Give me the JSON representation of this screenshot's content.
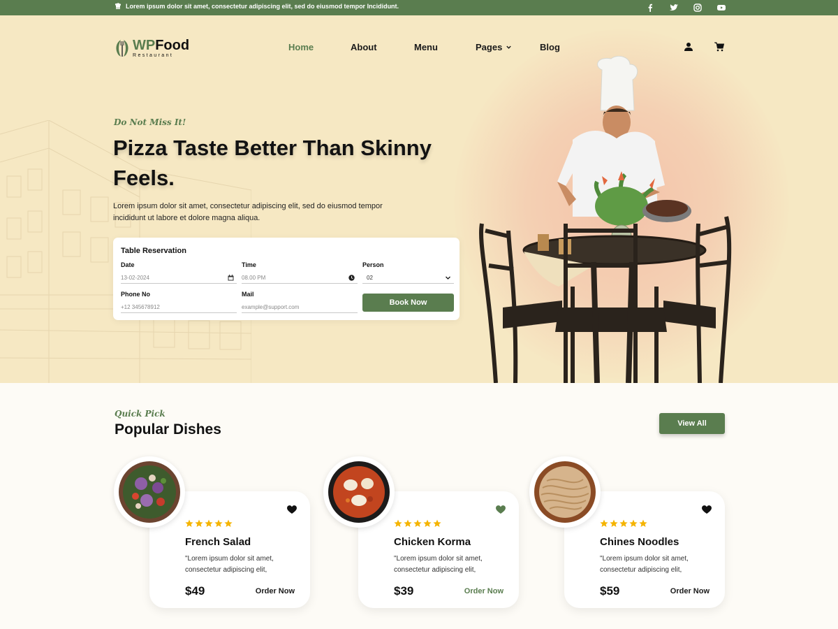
{
  "topbar": {
    "message": "Lorem ipsum dolor sit amet, consectetur adipiscing elit, sed do eiusmod tempor Incididunt.",
    "socials": [
      "facebook-icon",
      "twitter-icon",
      "instagram-icon",
      "youtube-icon"
    ]
  },
  "brand": {
    "prefix": "WP",
    "name": "Food",
    "tagline": "Restaurant"
  },
  "nav": {
    "items": [
      {
        "label": "Home",
        "active": true
      },
      {
        "label": "About"
      },
      {
        "label": "Menu"
      },
      {
        "label": "Pages",
        "dropdown": true
      },
      {
        "label": "Blog"
      }
    ]
  },
  "hero": {
    "eyebrow": "Do Not Miss It!",
    "title": "Pizza Taste Better Than Skinny Feels.",
    "description": "Lorem ipsum dolor sit amet, consectetur adipiscing elit, sed do eiusmod tempor incididunt ut labore et dolore magna aliqua."
  },
  "reservation": {
    "title": "Table Reservation",
    "date_label": "Date",
    "date_value": "13-02-2024",
    "time_label": "Time",
    "time_value": "08.00 PM",
    "person_label": "Person",
    "person_value": "02",
    "phone_label": "Phone No",
    "phone_placeholder": "+12 345678912",
    "mail_label": "Mail",
    "mail_placeholder": "example@support.com",
    "button": "Book Now"
  },
  "popular": {
    "eyebrow": "Quick Pick",
    "title": "Popular Dishes",
    "view_all": "View All",
    "dishes": [
      {
        "name": "French Salad",
        "desc": "\"Lorem ipsum dolor sit amet, consectetur adipiscing elit,",
        "price": "$49",
        "order": "Order Now",
        "rating": 5,
        "favorited": true
      },
      {
        "name": "Chicken Korma",
        "desc": "\"Lorem ipsum dolor sit amet, consectetur adipiscing elit,",
        "price": "$39",
        "order": "Order Now",
        "rating": 5,
        "favorited": true
      },
      {
        "name": "Chines Noodles",
        "desc": "\"Lorem ipsum dolor sit amet, consectetur adipiscing elit,",
        "price": "$59",
        "order": "Order Now",
        "rating": 5,
        "favorited": true
      }
    ]
  },
  "colors": {
    "accent": "#5a7d4f",
    "hero_bg": "#f6e8c3",
    "star": "#f5b400"
  }
}
